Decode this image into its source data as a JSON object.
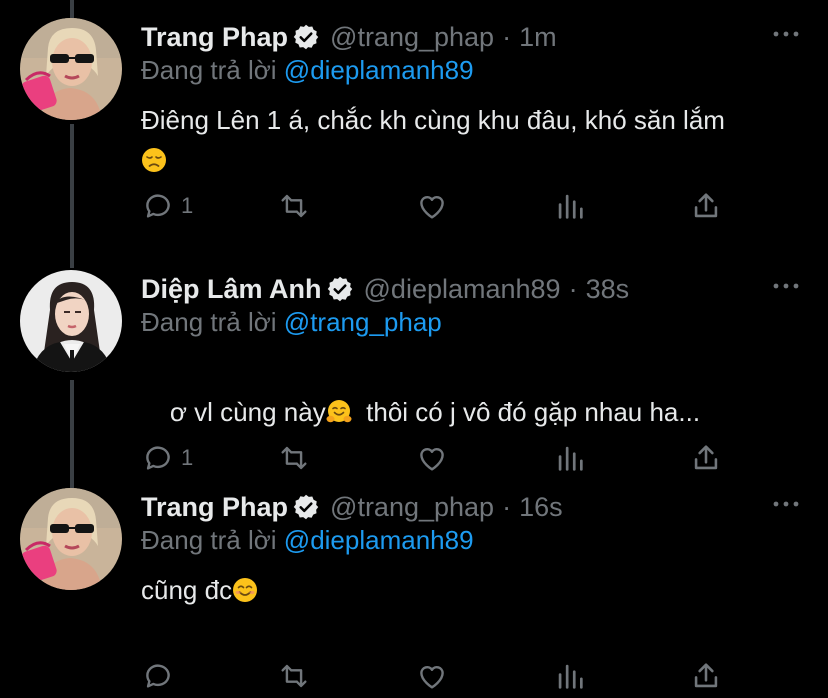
{
  "colors": {
    "background": "#000000",
    "text": "#e7e9ea",
    "secondary": "#71767b",
    "link": "#1d9bf0",
    "thread_line": "#3a3f44"
  },
  "tweets": [
    {
      "name": "Trang Phap",
      "handle": "@trang_phap",
      "separator": "·",
      "time": "1m",
      "reply_label": "Đang trả lời",
      "reply_to": "@dieplamanh89",
      "text": "Điêng Lên 1 á, chắc kh cùng khu đâu, khó săn lắm",
      "emoji": "disappointed-face-emoji",
      "reply_count": "1"
    },
    {
      "name": "Diệp Lâm Anh",
      "handle": "@dieplamanh89",
      "separator": "·",
      "time": "38s",
      "reply_label": "Đang trả lời",
      "reply_to": "@trang_phap",
      "text_before": "ơ vl cùng này",
      "emoji": "hugging-face-emoji",
      "text_after": "  thôi có j vô đó gặp nhau ha...",
      "reply_count": "1"
    },
    {
      "name": "Trang Phap",
      "handle": "@trang_phap",
      "separator": "·",
      "time": "16s",
      "reply_label": "Đang trả lời",
      "reply_to": "@dieplamanh89",
      "text": "cũng đc",
      "emoji": "smiling-face-emoji",
      "reply_count": ""
    }
  ]
}
